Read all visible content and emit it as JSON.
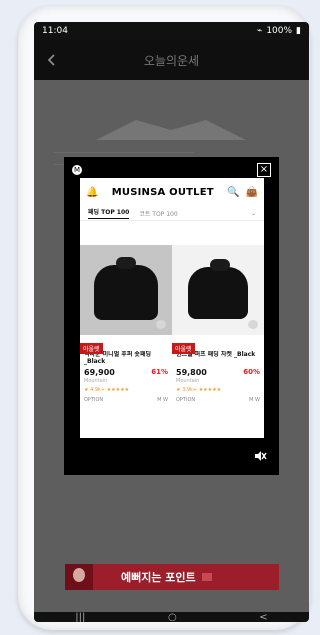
{
  "status": {
    "time": "11:04",
    "battery": "100%"
  },
  "appbar": {
    "title": "오늘의운세"
  },
  "modal": {
    "brand": "MUSINSA OUTLET",
    "close": "×",
    "logo_text": "M",
    "tabs": [
      "패딩 TOP 100",
      "코트 TOP 100"
    ],
    "products": [
      {
        "tag": "아울렛",
        "name": "덕다운 미니멀 푸퍼 숏패딩 _Black",
        "price": "69,900",
        "discount": "61%",
        "brand": "Mountain",
        "rating": "★ 4.9k+ ★★★★★",
        "option": "OPTION",
        "size": "M W"
      },
      {
        "tag": "아울렛",
        "name": "윈드쉘 퍼프 패딩 자켓 _Black",
        "price": "59,800",
        "discount": "60%",
        "brand": "Mountain",
        "rating": "★ 3.9k+ ★★★★★",
        "option": "OPTION",
        "size": "M W"
      }
    ]
  },
  "banner": {
    "text": "예뻐지는 포인트"
  },
  "nav": [
    "|||",
    "○",
    "<"
  ]
}
